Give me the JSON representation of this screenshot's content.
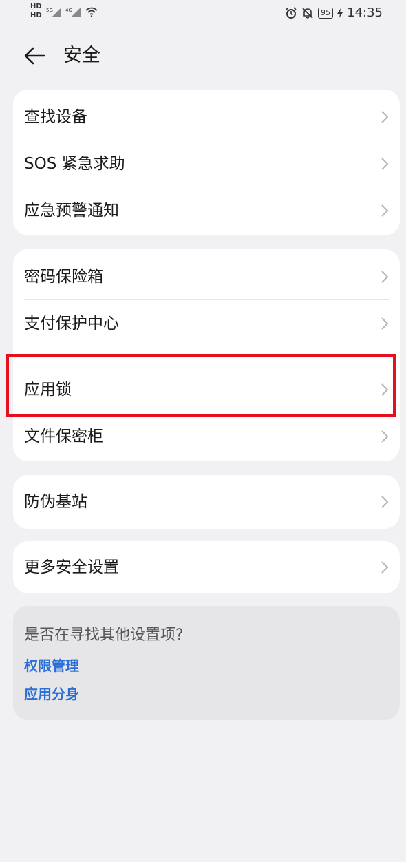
{
  "status_bar": {
    "sim_labels": [
      "HD",
      "HD"
    ],
    "signal_labels": [
      "5G",
      "4G"
    ],
    "battery": "95",
    "time": "14:35"
  },
  "header": {
    "title": "安全"
  },
  "groups": [
    {
      "items": [
        {
          "label": "查找设备"
        },
        {
          "label": "SOS 紧急求助"
        },
        {
          "label": "应急预警通知"
        }
      ]
    },
    {
      "items": [
        {
          "label": "密码保险箱"
        },
        {
          "label": "支付保护中心"
        },
        {
          "label": "应用锁"
        },
        {
          "label": "文件保密柜"
        }
      ]
    },
    {
      "items": [
        {
          "label": "防伪基站"
        }
      ]
    },
    {
      "items": [
        {
          "label": "更多安全设置"
        }
      ]
    }
  ],
  "suggestions": {
    "title": "是否在寻找其他设置项?",
    "links": [
      "权限管理",
      "应用分身"
    ]
  },
  "accent_colors": {
    "highlight": "#e4101e",
    "link": "#2a6fd6"
  }
}
